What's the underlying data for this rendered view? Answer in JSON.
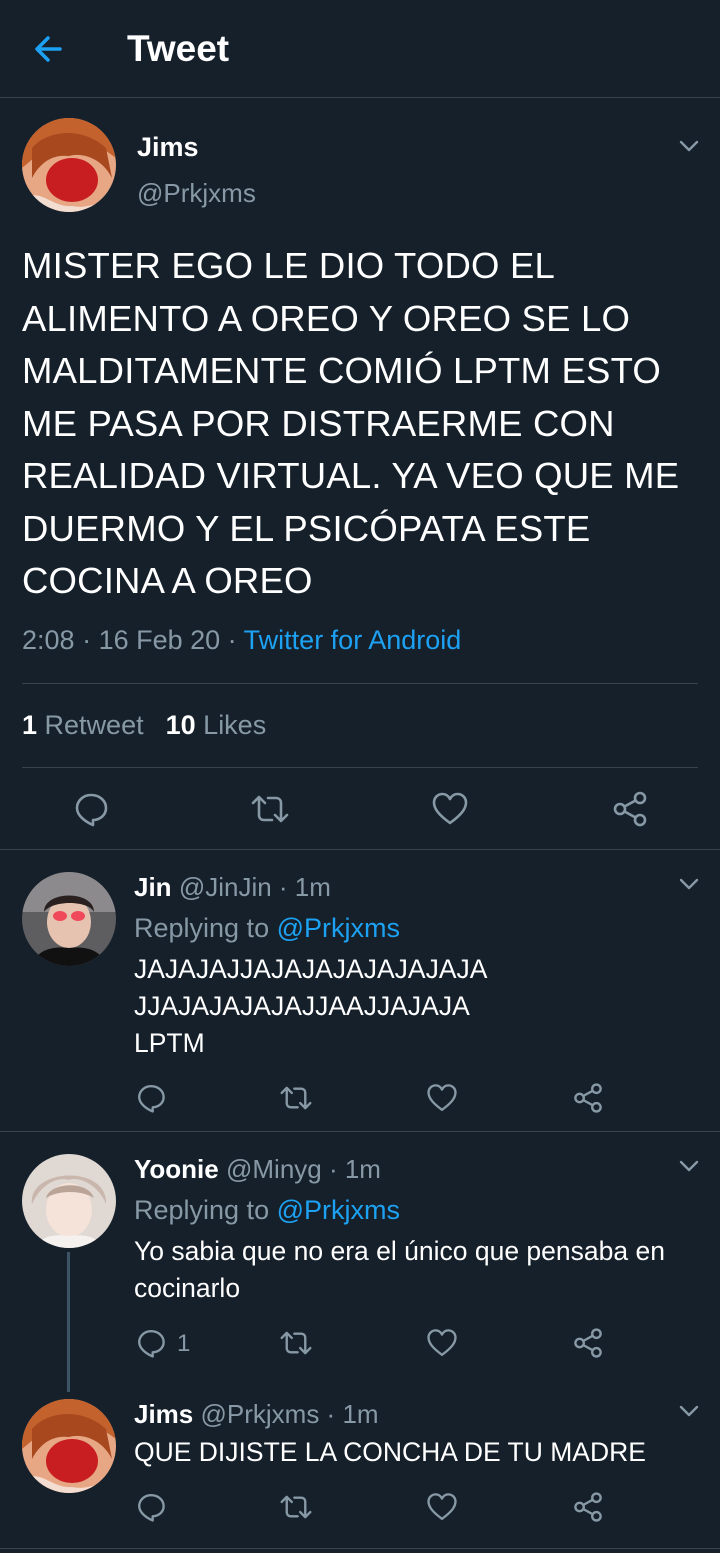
{
  "header": {
    "title": "Tweet"
  },
  "tweet": {
    "name": "Jims",
    "handle": "@Prkjxms",
    "text": "MISTER EGO LE DIO TODO EL ALIMENTO A OREO Y OREO SE LO MALDITAMENTE COMIÓ LPTM ESTO ME PASA POR DISTRAERME CON REALIDAD VIRTUAL. YA VEO QUE ME DUERMO Y EL PSICÓPATA ESTE COCINA A OREO",
    "time": "2:08",
    "date": "16 Feb 20",
    "source": "Twitter for Android",
    "retweet_count": "1",
    "retweet_label": "Retweet",
    "like_count": "10",
    "like_label": "Likes"
  },
  "replies": [
    {
      "name": "Jin",
      "handle": "@JinJin",
      "time": "1m",
      "replying_label": "Replying to",
      "replying_to": "@Prkjxms",
      "text_lines": [
        "JAJAJAJJAJAJAJAJAJAJAJA",
        "JJAJAJAJAJAJJAAJJAJAJA",
        "LPTM"
      ]
    },
    {
      "name": "Yoonie",
      "handle": "@Minyg",
      "time": "1m",
      "replying_label": "Replying to",
      "replying_to": "@Prkjxms",
      "text_lines": [
        "Yo sabia que no era el único que pensaba en",
        "cocinarlo"
      ],
      "reply_count": "1"
    },
    {
      "name": "Jims",
      "handle": "@Prkjxms",
      "time": "1m",
      "text_lines": [
        "QUE DIJISTE LA CONCHA DE TU MADRE"
      ]
    }
  ],
  "icons": {
    "back": "arrow-left-icon",
    "caret": "chevron-down-icon",
    "reply": "comment-icon",
    "retweet": "retweet-icon",
    "like": "heart-icon",
    "share": "share-icon"
  },
  "colors": {
    "background": "#15202b",
    "divider": "#38444d",
    "secondary_text": "#8899a6",
    "accent": "#1da1f2"
  }
}
